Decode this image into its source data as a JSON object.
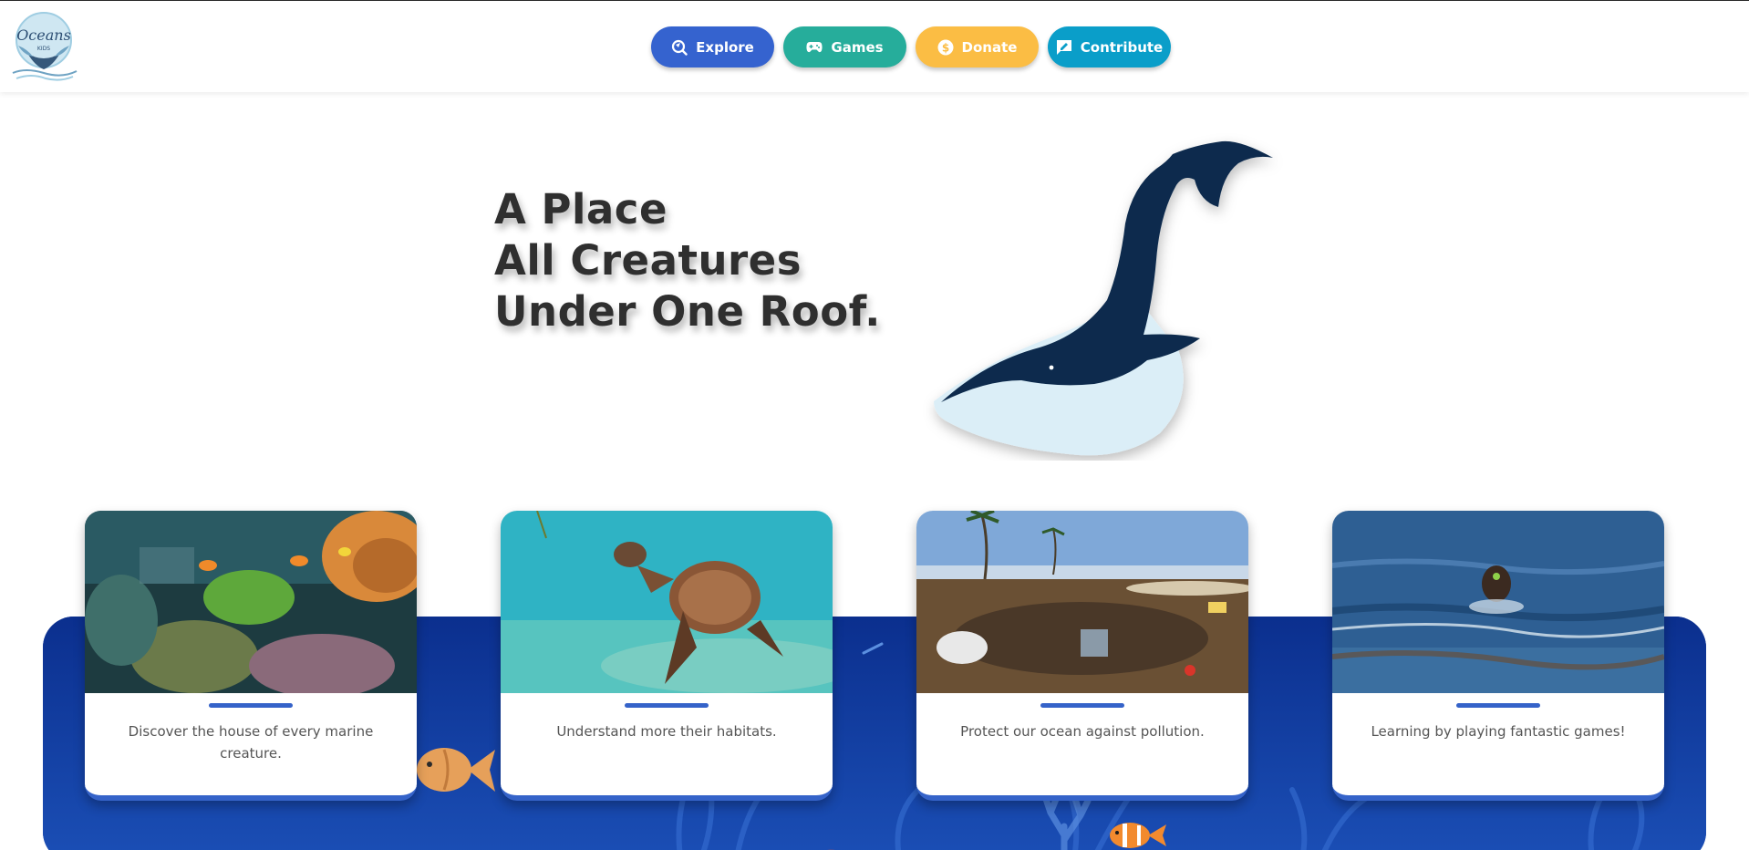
{
  "nav": {
    "logo_text": "Oceans",
    "logo_subtext": "KIDS",
    "buttons": [
      {
        "label": "Explore",
        "icon": "explore-icon",
        "color": "#3563cf"
      },
      {
        "label": "Games",
        "icon": "gamepad-icon",
        "color": "#26ad9b"
      },
      {
        "label": "Donate",
        "icon": "dollar-coin-icon",
        "color": "#fbbd44"
      },
      {
        "label": "Contribute",
        "icon": "edit-message-icon",
        "color": "#0a9ec9"
      }
    ]
  },
  "hero": {
    "line1": "A Place",
    "line2": "All Creatures",
    "line3": "Under One Roof."
  },
  "cards": [
    {
      "text": "Discover the house of every marine creature.",
      "image": "coral reef with clownfish"
    },
    {
      "text": "Understand more their habitats.",
      "image": "sea turtle swimming"
    },
    {
      "text": "Protect our ocean against pollution.",
      "image": "polluted beach"
    },
    {
      "text": "Learning by playing fantastic games!",
      "image": "dog running in sea"
    }
  ],
  "colors": {
    "accent": "#3563c9",
    "panel": "#0a2f8a",
    "whale": "#0c2c4d",
    "whale_belly": "#dbeef7"
  }
}
